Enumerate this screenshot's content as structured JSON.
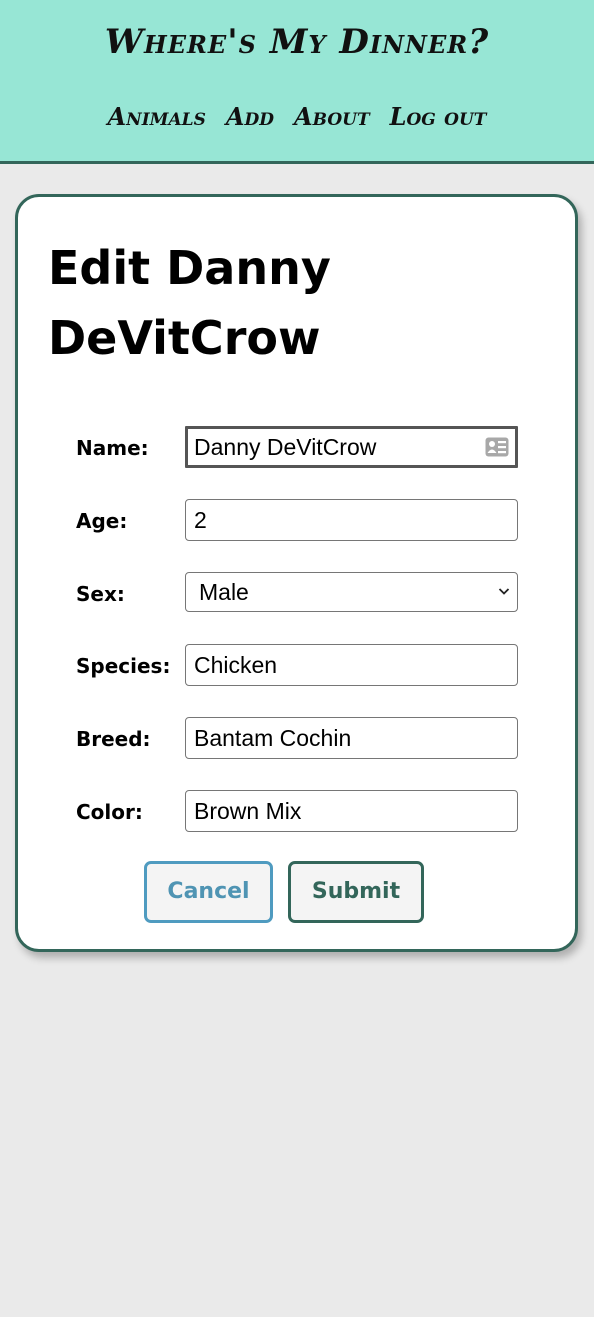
{
  "header": {
    "title": "Where's My Dinner?",
    "nav": [
      {
        "label": "Animals"
      },
      {
        "label": "Add"
      },
      {
        "label": "About"
      },
      {
        "label": "Log out"
      }
    ]
  },
  "form": {
    "title": "Edit Danny DeVitCrow",
    "fields": {
      "name": {
        "label": "Name:",
        "value": "Danny DeVitCrow",
        "icon": "contact-card-icon"
      },
      "age": {
        "label": "Age:",
        "value": "2"
      },
      "sex": {
        "label": "Sex:",
        "value": "Male",
        "icon": "chevron-down-icon"
      },
      "species": {
        "label": "Species:",
        "value": "Chicken"
      },
      "breed": {
        "label": "Breed:",
        "value": "Bantam Cochin"
      },
      "color": {
        "label": "Color:",
        "value": "Brown Mix"
      }
    },
    "cancel_label": "Cancel",
    "submit_label": "Submit"
  },
  "colors": {
    "header_bg": "#97e6d5",
    "accent_dark": "#33665a",
    "cancel_blue": "#4f9bc0",
    "page_bg": "#eaeaea"
  }
}
